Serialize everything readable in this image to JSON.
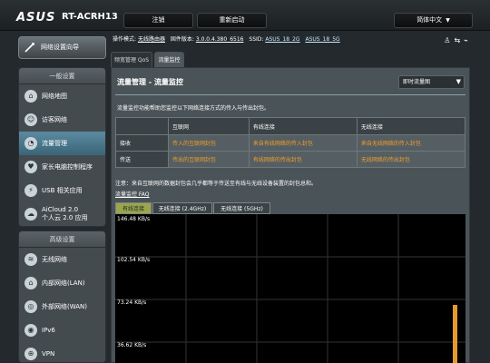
{
  "header": {
    "logo": "ASUS",
    "model": "RT-ACRH13",
    "logout_label": "注销",
    "reboot_label": "重新启动",
    "language_label": "简体中文"
  },
  "sidebar": {
    "quick_setup": "网络设置向导",
    "general_title": "一般设置",
    "general_items": [
      {
        "label": "网络地图",
        "icon": "network-map-icon"
      },
      {
        "label": "访客网络",
        "icon": "guest-network-icon"
      },
      {
        "label": "流量管理",
        "icon": "traffic-manager-icon",
        "active": true
      },
      {
        "label": "家长电脑控制程序",
        "icon": "parental-control-icon"
      },
      {
        "label": "USB 相关应用",
        "icon": "usb-icon"
      },
      {
        "label": "AiCloud 2.0",
        "label2": "个人云 2.0 应用",
        "icon": "cloud-icon"
      }
    ],
    "advanced_title": "高级设置",
    "advanced_items": [
      {
        "label": "无线网络",
        "icon": "wireless-icon"
      },
      {
        "label": "内部网络(LAN)",
        "icon": "lan-icon"
      },
      {
        "label": "外部网络(WAN)",
        "icon": "wan-icon"
      },
      {
        "label": "IPv6",
        "icon": "ipv6-icon"
      },
      {
        "label": "VPN",
        "icon": "vpn-icon"
      }
    ]
  },
  "infobar": {
    "mode_key": "操作模式:",
    "mode_val": "无线路由器",
    "fw_key": "固件版本:",
    "fw_val": "3.0.0.4.380_6516",
    "ssid_key": "SSID:",
    "ssid_1": "ASUS_18_2G",
    "ssid_2": "ASUS_18_5G"
  },
  "tabs": {
    "qos": "频宽管理 QoS",
    "monitor": "流量监控"
  },
  "main": {
    "title": "流量管理 - 流量监控",
    "view_select": "即时流量图",
    "description": "流量监控功能帮助您监控以下网络连接方式的传入与传出封包。",
    "headers": [
      "互联网",
      "有线连接",
      "无线连接"
    ],
    "rows": [
      {
        "label": "接收",
        "cells": [
          "传入的互联网封包",
          "来自有线网络的传入封包",
          "来自无线网络的传入封包"
        ]
      },
      {
        "label": "传送",
        "cells": [
          "传出的互联网封包",
          "有线网络的传出封包",
          "无线网络的传出封包"
        ]
      }
    ],
    "note": "注意：来自互联网的数据封包会几乎都等于传送至有线与无线设备装置的封包总和。",
    "faq": "流量监控 FAQ",
    "graph_tabs": [
      "有线连接",
      "无线连接 (2.4GHz)",
      "无线连接 (5GHz)"
    ],
    "graph_labels": [
      "146.48 KB/s",
      "102.54 KB/s",
      "73.24 KB/s",
      "36.62 KB/s"
    ]
  },
  "colors": {
    "accent_orange": "#f29e2a",
    "active_tab_green": "#9ba64b",
    "graph_bg": "#000000"
  }
}
